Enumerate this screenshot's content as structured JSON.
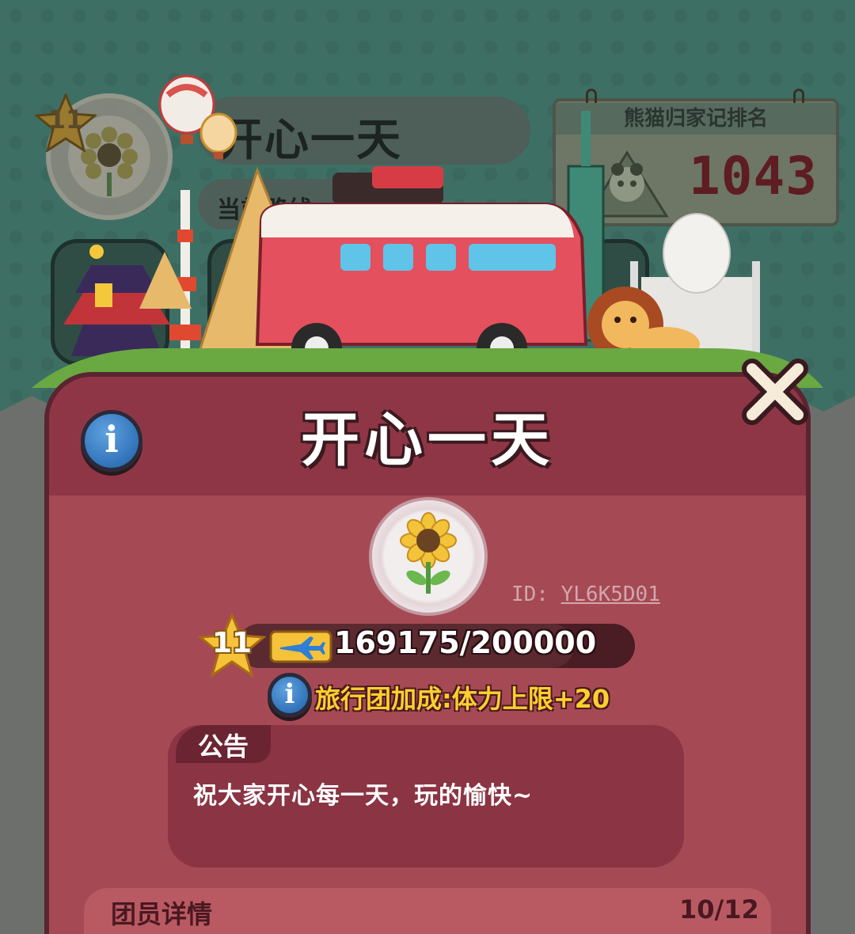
{
  "background": {
    "dim_level": "11",
    "dim_team_name": "开心一天",
    "dim_subtitle": "当前路线",
    "rank_board": {
      "title": "熊猫归家记排名",
      "rank": "1043"
    }
  },
  "panel": {
    "title": "开心一天",
    "team_id_prefix": "ID:",
    "team_id": "YL6K5D01",
    "level": "11",
    "progress": {
      "current": 169175,
      "max": 200000,
      "text": "169175/200000"
    },
    "bonus_text": "旅行团加成:体力上限+20",
    "notice": {
      "title": "公告",
      "body": "祝大家开心每一天，玩的愉快~"
    },
    "members": {
      "label": "团员详情",
      "count": "10/12"
    }
  },
  "icons": {
    "info": "info-icon",
    "close": "close-icon",
    "badge": "sunflower-icon",
    "ticket": "plane-ticket-icon",
    "star": "level-star-icon"
  },
  "colors": {
    "panel": "#a54a55",
    "panel_header": "#8f3646",
    "bonus_text": "#ffcf2e",
    "info_blue": "#1e5fa8"
  }
}
